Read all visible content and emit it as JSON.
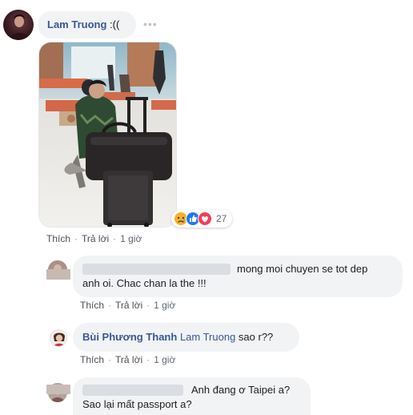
{
  "main_comment": {
    "author": "Lam Truong",
    "text": " :((",
    "reactions_count": "27"
  },
  "action_labels": {
    "like": "Thích",
    "reply": "Trả lời"
  },
  "main_actions": {
    "time": "1 giờ"
  },
  "replies": [
    {
      "line1": "mong moi chuyen se tot dep",
      "line2": "anh oi. Chac chan la the !!!",
      "time": "1 giờ"
    },
    {
      "author": "Bùi Phương Thanh",
      "mention": "Lam Truong",
      "text": " sao r??",
      "time": "1 giờ"
    },
    {
      "line1": "Anh đang ơ Taipei a?",
      "line2": "Sao lại mất passport a?"
    }
  ],
  "colors": {
    "link": "#385898",
    "bubble": "#f2f3f5",
    "like": "#2078f4",
    "love": "#f33e58",
    "sad": "#f7b125"
  }
}
